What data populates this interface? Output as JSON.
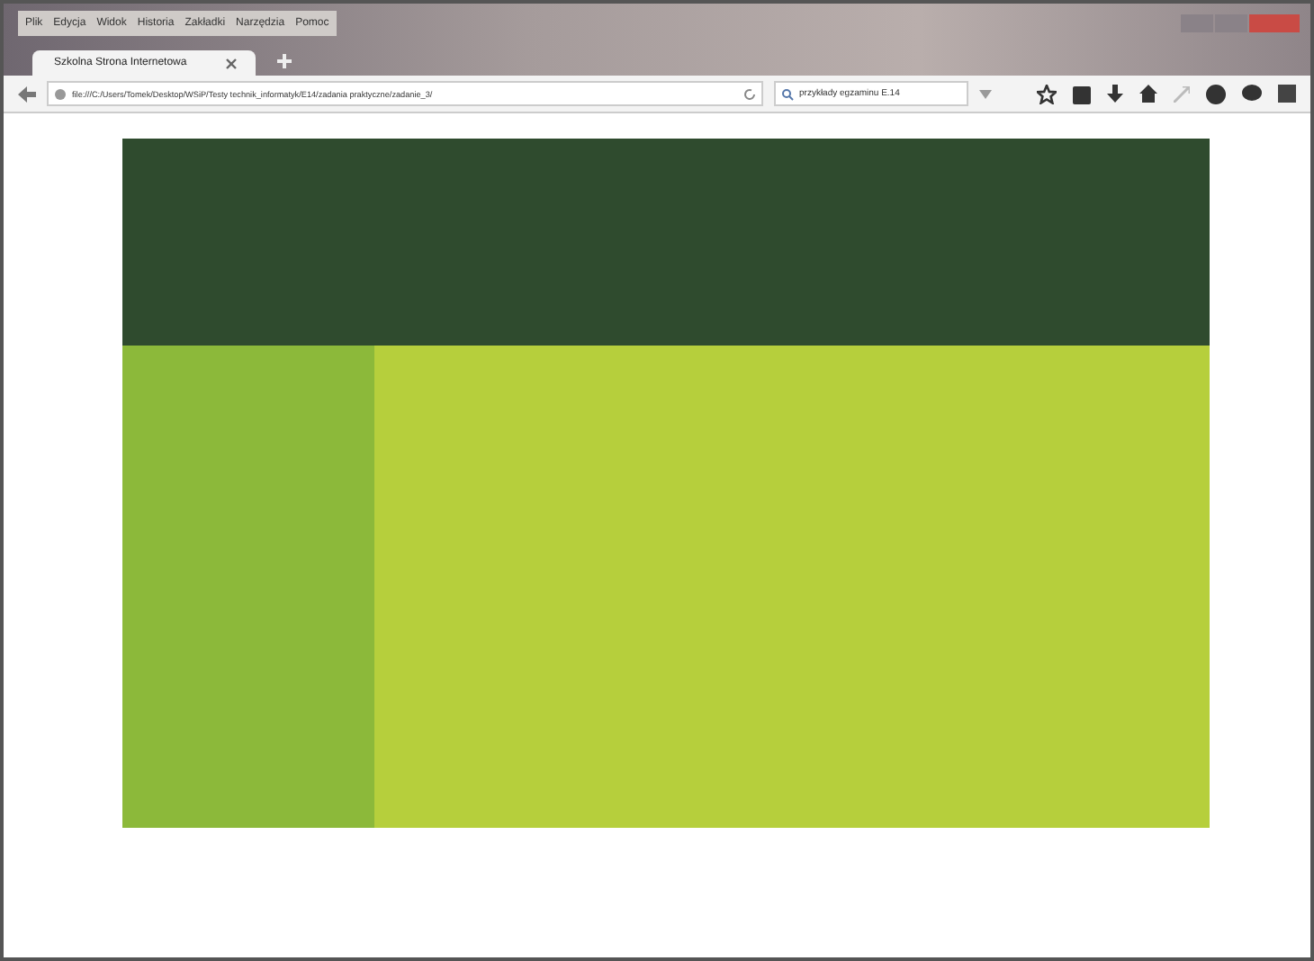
{
  "menu_bar": [
    "Plik",
    "Edycja",
    "Widok",
    "Historia",
    "Zakładki",
    "Narzędzia",
    "Pomoc"
  ],
  "tab": {
    "title": "Szkolna Strona Internetowa",
    "selected": true
  },
  "address_bar": {
    "value": "file:///C:/Users/Tomek/Desktop/WSiP/Testy technik_informatyk/E14/zadania praktyczne/zadanie_3/"
  },
  "search": {
    "value": "przykłady egzaminu E.14"
  }
}
